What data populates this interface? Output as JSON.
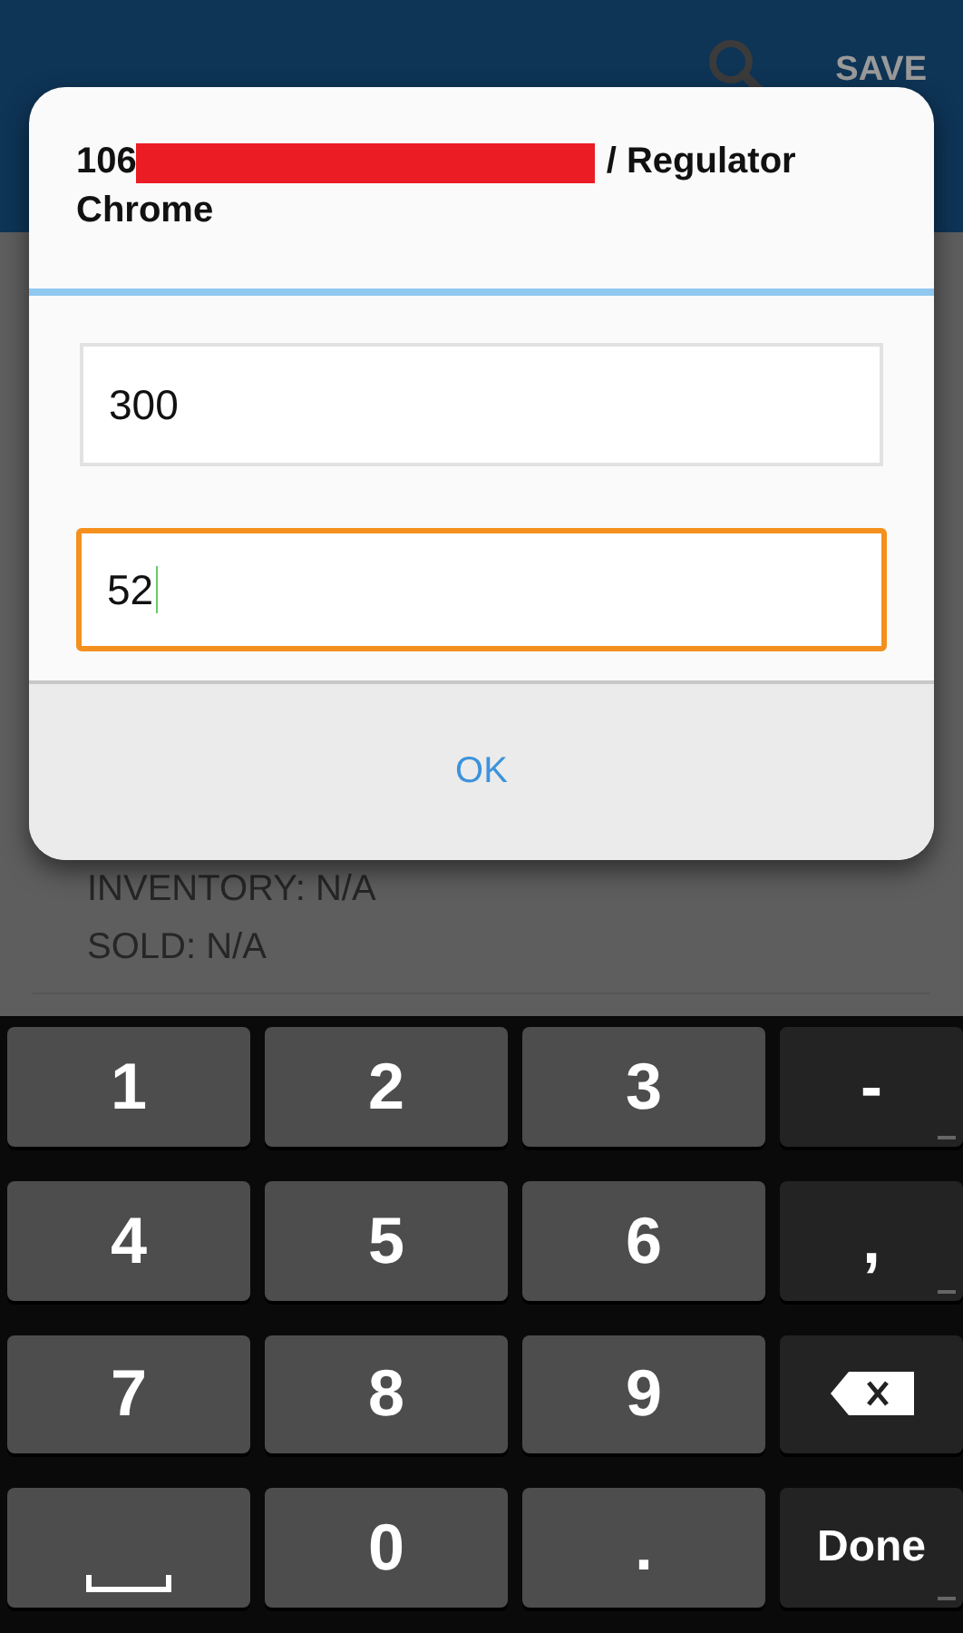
{
  "app_bar": {
    "action": "SAVE"
  },
  "background": {
    "lines": [
      "INVENTORY: N/A",
      "SOLD: N/A"
    ]
  },
  "dialog": {
    "title_start": "106",
    "title_redacted": true,
    "title_end": "/ Regulator",
    "title_line2": "Chrome",
    "fields": [
      {
        "value": "300",
        "focused": false
      },
      {
        "value": "52",
        "focused": true
      }
    ],
    "button": "OK"
  },
  "keyboard": {
    "keys": [
      {
        "kind": "digit",
        "label": "1"
      },
      {
        "kind": "digit",
        "label": "2"
      },
      {
        "kind": "digit",
        "label": "3"
      },
      {
        "kind": "symbol",
        "label": "-"
      },
      {
        "kind": "digit",
        "label": "4"
      },
      {
        "kind": "digit",
        "label": "5"
      },
      {
        "kind": "digit",
        "label": "6"
      },
      {
        "kind": "symbol",
        "label": ","
      },
      {
        "kind": "digit",
        "label": "7"
      },
      {
        "kind": "digit",
        "label": "8"
      },
      {
        "kind": "digit",
        "label": "9"
      },
      {
        "kind": "backspace"
      },
      {
        "kind": "space"
      },
      {
        "kind": "digit",
        "label": "0"
      },
      {
        "kind": "digit",
        "label": "."
      },
      {
        "kind": "done",
        "label": "Done"
      }
    ]
  }
}
